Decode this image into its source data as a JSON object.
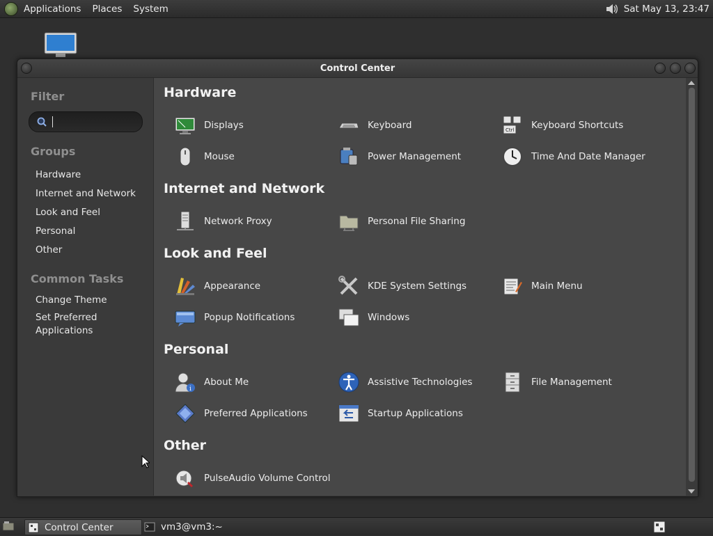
{
  "top_panel": {
    "menus": [
      "Applications",
      "Places",
      "System"
    ],
    "clock": "Sat May 13, 23:47"
  },
  "window": {
    "title": "Control Center"
  },
  "sidebar": {
    "filter_heading": "Filter",
    "search": {
      "value": "",
      "placeholder": ""
    },
    "groups_heading": "Groups",
    "groups": [
      "Hardware",
      "Internet and Network",
      "Look and Feel",
      "Personal",
      "Other"
    ],
    "tasks_heading": "Common Tasks",
    "tasks": [
      "Change Theme",
      "Set Preferred Applications"
    ]
  },
  "content": {
    "sections": [
      {
        "title": "Hardware",
        "items": [
          {
            "label": "Displays",
            "icon": "display-icon"
          },
          {
            "label": "Keyboard",
            "icon": "keyboard-icon"
          },
          {
            "label": "Keyboard Shortcuts",
            "icon": "keyboard-shortcuts-icon"
          },
          {
            "label": "Mouse",
            "icon": "mouse-icon"
          },
          {
            "label": "Power Management",
            "icon": "power-management-icon"
          },
          {
            "label": "Time And Date Manager",
            "icon": "clock-icon"
          }
        ]
      },
      {
        "title": "Internet and Network",
        "items": [
          {
            "label": "Network Proxy",
            "icon": "network-proxy-icon"
          },
          {
            "label": "Personal File Sharing",
            "icon": "folder-share-icon"
          }
        ]
      },
      {
        "title": "Look and Feel",
        "items": [
          {
            "label": "Appearance",
            "icon": "appearance-icon"
          },
          {
            "label": "KDE System Settings",
            "icon": "tools-icon"
          },
          {
            "label": "Main Menu",
            "icon": "main-menu-icon"
          },
          {
            "label": "Popup Notifications",
            "icon": "notification-icon"
          },
          {
            "label": "Windows",
            "icon": "windows-icon"
          }
        ]
      },
      {
        "title": "Personal",
        "items": [
          {
            "label": "About Me",
            "icon": "user-info-icon"
          },
          {
            "label": "Assistive Technologies",
            "icon": "accessibility-icon"
          },
          {
            "label": "File Management",
            "icon": "file-cabinet-icon"
          },
          {
            "label": "Preferred Applications",
            "icon": "preferred-apps-icon"
          },
          {
            "label": "Startup Applications",
            "icon": "startup-apps-icon"
          }
        ]
      },
      {
        "title": "Other",
        "items": [
          {
            "label": "PulseAudio Volume Control",
            "icon": "volume-control-icon"
          }
        ]
      }
    ]
  },
  "taskbar": {
    "tasks": [
      {
        "label": "Control Center",
        "active": true
      },
      {
        "label": "vm3@vm3:~",
        "active": false
      }
    ]
  }
}
